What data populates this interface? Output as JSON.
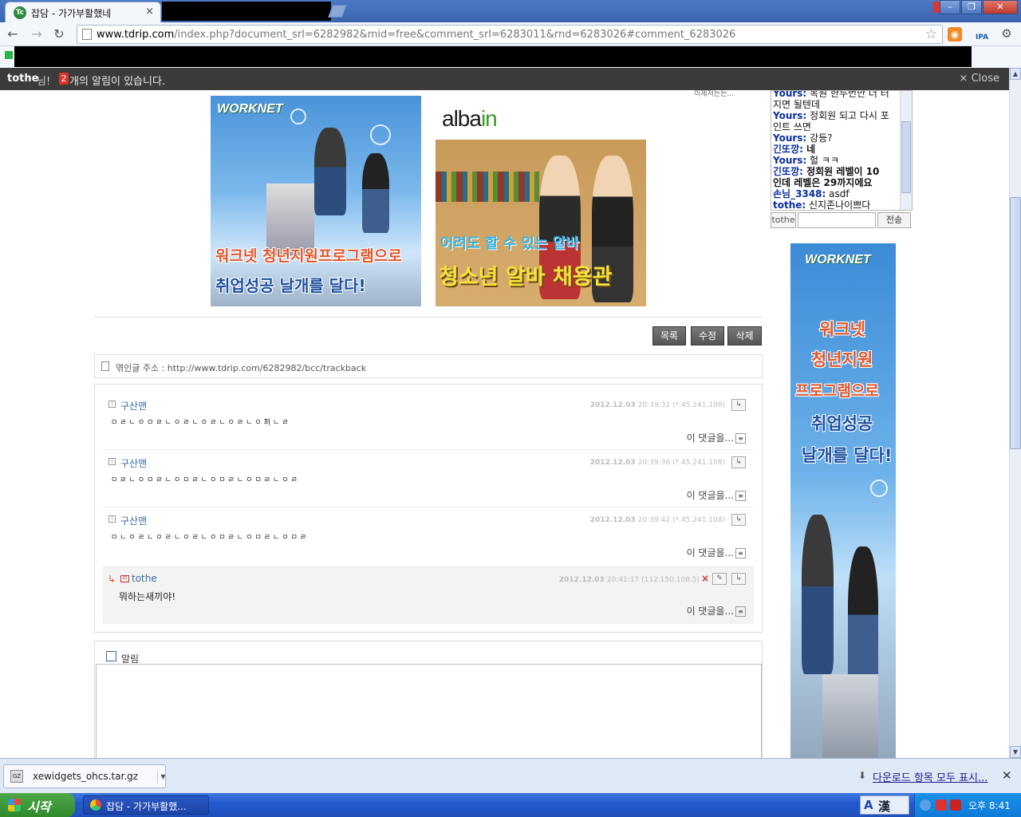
{
  "browser": {
    "tab_title": "잡담 - 가가부활했네",
    "tab_close": "×",
    "favicon_text": "Tc",
    "url_host": "www.tdrip.com",
    "url_rest": "/index.php?document_srl=6282982&mid=free&comment_srl=6283011&rnd=6283026#comment_6283026",
    "ext_label": "IPA"
  },
  "notify_bar": {
    "user": "tothe",
    "suffix": "님!",
    "count": "2",
    "message": "개의 알림이 있습니다.",
    "close_label": "× Close"
  },
  "ads": {
    "worknet_logo": "WORKNET",
    "worknet_line1": "워크넷 청년지원프로그램으로",
    "worknet_line2": "취업성공 날개를 달다!",
    "albain_logo_a": "alba",
    "albain_logo_b": "in",
    "albain_line1": "어려도 할 수 있는 알바",
    "albain_line2": "청소년 알바 채용관",
    "side_logo": "WORKNET",
    "side_line1": "워크넷",
    "side_line2": "청년지원",
    "side_line3": "프로그램으로",
    "side_line4": "취업성공",
    "side_line5": "날개를 달다!"
  },
  "buttons": {
    "list": "목록",
    "edit": "수정",
    "delete": "삭제"
  },
  "trackback": {
    "label": "엮인글 주소 : http://www.tdrip.com/6282982/bcc/trackback"
  },
  "comments": [
    {
      "author": "구산맨",
      "date": "2012.12.03",
      "time_ip": "20:39:31 (*.45.241.108)",
      "text": "ㅁㄹㄴㅇㅁㄹㄴㅇㄹㄴㅇㄹㄴㅇㄹㄴㅇ퍼ㄴㄹ",
      "more": "이 댓글을..."
    },
    {
      "author": "구산맨",
      "date": "2012.12.03",
      "time_ip": "20:39:36 (*.45.241.108)",
      "text": "ㅁㄹㄴㅇㅁㄹㄴㅇㅁㄹㄴㅇㅁㄹㄴㅇㅁㄹㄴㅇㄹ",
      "more": "이 댓글을..."
    },
    {
      "author": "구산맨",
      "date": "2012.12.03",
      "time_ip": "20:39:42 (*.45.241.108)",
      "text": "ㅁㄴㅇㄹㄴㅇㄹㄴㅇㄹㄴㅇㅁㄹㄴㅇㅁㄹㄴㅇㅁㄹ",
      "more": "이 댓글을..."
    },
    {
      "author": "tothe",
      "date": "2012.12.03",
      "time_ip": "20:41:17 (112.150.108.5)",
      "text": "뭐하는새끼야!",
      "more": "이 댓글을...",
      "reply_arrow": "↳",
      "delete_mark": "×"
    }
  ],
  "reply_form": {
    "notify_label": "알림"
  },
  "chat": {
    "top_snippet": "이제저는는...",
    "lines": [
      {
        "who": "Yours:",
        "text": " 복원 한두번만 더 터"
      },
      {
        "who": "",
        "text": "지면 될텐데"
      },
      {
        "who": "Yours:",
        "text": " 정회원 되고 다시 포"
      },
      {
        "who": "",
        "text": "인트 쓰면"
      },
      {
        "who": "Yours:",
        "text": " 강등?"
      },
      {
        "who": "긴또깡:",
        "text": " 네"
      },
      {
        "who": "Yours:",
        "text": " 헐 ㅋㅋ"
      },
      {
        "who": "긴또깡:",
        "text": " 정회원 레벨이 10"
      },
      {
        "who": "",
        "text": "인데 레벨은 29까지에요"
      },
      {
        "who": "손님_3348:",
        "text": " asdf"
      },
      {
        "who": "tothe:",
        "text": " 신지존나이쁘다"
      }
    ],
    "nick": "tothe",
    "send_label": "전송"
  },
  "download_shelf": {
    "file_name": "xewidgets_ohcs.tar.gz",
    "file_icon_text": "GZ",
    "show_all": "다운로드 항목 모두 표시...",
    "close": "✕"
  },
  "taskbar": {
    "start_label": "시작",
    "task_label": "잡담 - 가가부활했...",
    "ime_a": "A",
    "ime_han": "漢",
    "clock": "오후 8:41"
  }
}
